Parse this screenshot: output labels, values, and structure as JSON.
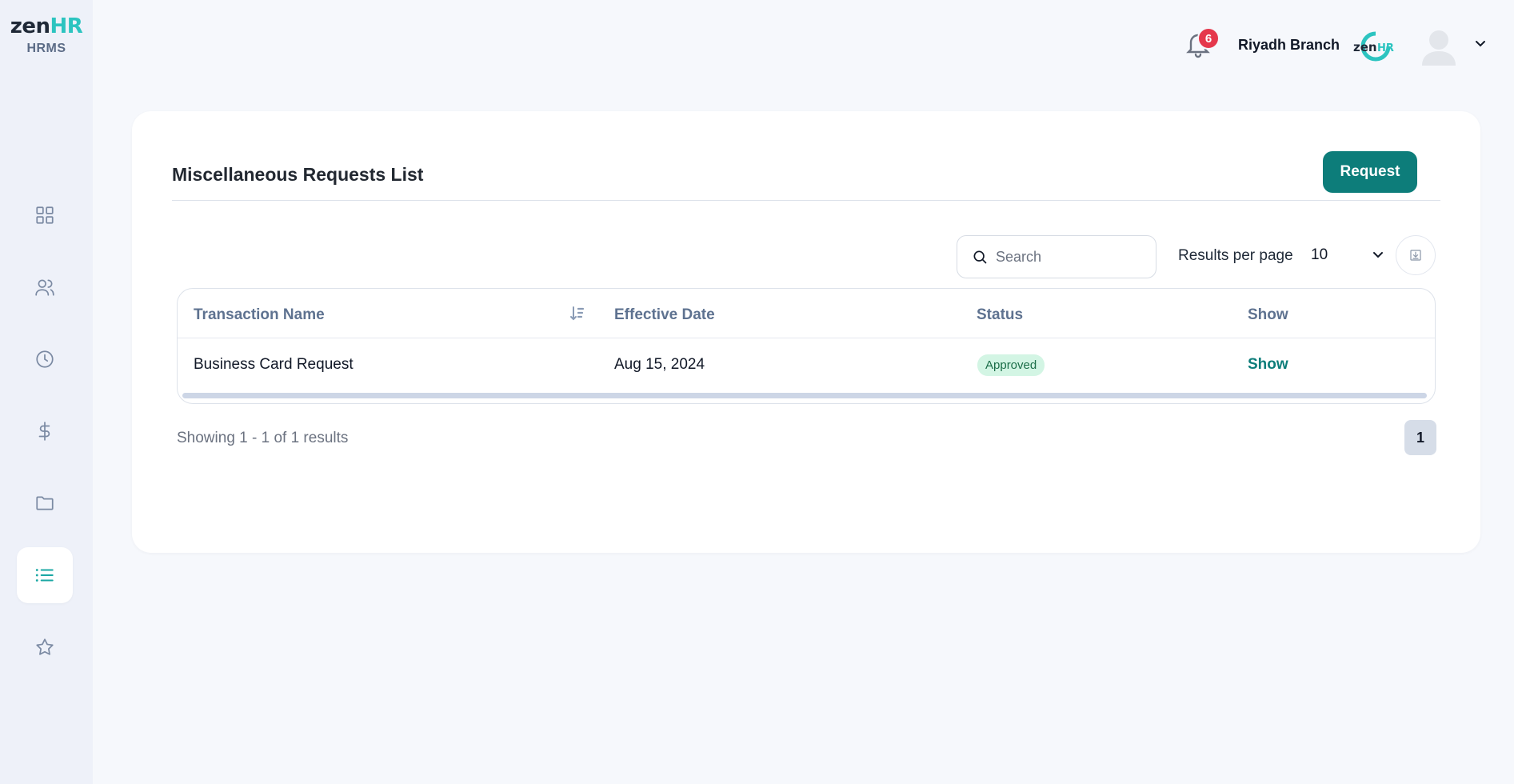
{
  "app": {
    "brand_zen": "zen",
    "brand_hr": "HR",
    "subtitle": "HRMS"
  },
  "topbar": {
    "notification_count": "6",
    "branch_name": "Riyadh Branch"
  },
  "sidebar": {
    "items": [
      {
        "icon": "dashboard-grid-icon",
        "active": false
      },
      {
        "icon": "users-icon",
        "active": false
      },
      {
        "icon": "clock-icon",
        "active": false
      },
      {
        "icon": "dollar-icon",
        "active": false
      },
      {
        "icon": "folder-icon",
        "active": false
      },
      {
        "icon": "list-icon",
        "active": true
      },
      {
        "icon": "star-icon",
        "active": false
      }
    ]
  },
  "page": {
    "title": "Miscellaneous Requests List",
    "request_button": "Request"
  },
  "toolbar": {
    "search_placeholder": "Search",
    "results_per_page_label": "Results per page",
    "results_per_page_value": "10"
  },
  "table": {
    "columns": [
      "Transaction Name",
      "Effective Date",
      "Status",
      "Show"
    ],
    "rows": [
      {
        "transaction_name": "Business Card Request",
        "effective_date": "Aug 15, 2024",
        "status": "Approved",
        "show": "Show"
      }
    ]
  },
  "pagination": {
    "summary": "Showing 1 - 1 of 1 results",
    "current_page": "1"
  },
  "colors": {
    "accent": "#0d7d7a",
    "brand_teal": "#2cc4c0",
    "badge_red": "#e5384c",
    "approved_bg": "#d3f5e4",
    "approved_text": "#1b6e48"
  }
}
